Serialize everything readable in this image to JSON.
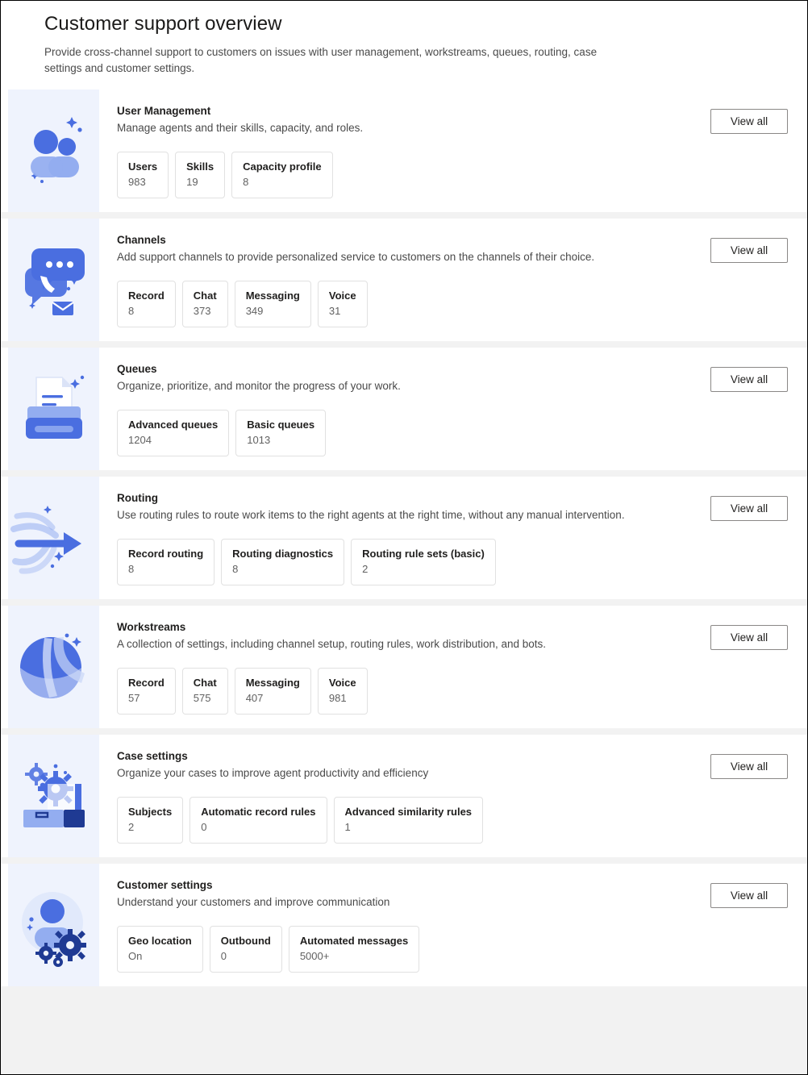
{
  "header": {
    "title": "Customer support overview",
    "subtitle": "Provide cross-channel support to customers on issues with user management, workstreams, queues, routing, case settings and customer settings."
  },
  "common": {
    "view_all_label": "View all"
  },
  "colors": {
    "icon_panel_bg": "#eff3fd",
    "accent_blue": "#4a6ee0",
    "accent_blue_light": "#93adf0",
    "accent_blue_dark": "#1f3a93",
    "page_bg": "#f2f2f2",
    "card_bg": "#ffffff",
    "heading_text": "#201f1e",
    "body_text": "#4a4a4a",
    "value_text": "#616161",
    "tile_border": "#e1e1e1",
    "button_border": "#8a8886"
  },
  "cards": [
    {
      "id": "user-management",
      "icon": "people-icon",
      "heading": "User Management",
      "description": "Manage agents and their skills, capacity, and roles.",
      "action_label": "View all",
      "stats": [
        {
          "label": "Users",
          "value": "983"
        },
        {
          "label": "Skills",
          "value": "19"
        },
        {
          "label": "Capacity profile",
          "value": "8"
        }
      ]
    },
    {
      "id": "channels",
      "icon": "chat-phone-mail-icon",
      "heading": "Channels",
      "description": "Add support channels to provide personalized service to customers on the channels of their choice.",
      "action_label": "View all",
      "stats": [
        {
          "label": "Record",
          "value": "8"
        },
        {
          "label": "Chat",
          "value": "373"
        },
        {
          "label": "Messaging",
          "value": "349"
        },
        {
          "label": "Voice",
          "value": "31"
        }
      ]
    },
    {
      "id": "queues",
      "icon": "document-tray-icon",
      "heading": "Queues",
      "description": "Organize, prioritize, and monitor the progress of your work.",
      "action_label": "View all",
      "stats": [
        {
          "label": "Advanced queues",
          "value": "1204"
        },
        {
          "label": "Basic queues",
          "value": "1013"
        }
      ]
    },
    {
      "id": "routing",
      "icon": "arrow-flow-icon",
      "heading": "Routing",
      "description": "Use routing rules to route work items to the right agents at the right time, without any manual intervention.",
      "action_label": "View all",
      "stats": [
        {
          "label": "Record routing",
          "value": "8"
        },
        {
          "label": "Routing diagnostics",
          "value": "8"
        },
        {
          "label": "Routing rule sets (basic)",
          "value": "2"
        }
      ]
    },
    {
      "id": "workstreams",
      "icon": "sphere-icon",
      "heading": "Workstreams",
      "description": "A collection of settings, including channel setup, routing rules, work distribution, and bots.",
      "action_label": "View all",
      "stats": [
        {
          "label": "Record",
          "value": "57"
        },
        {
          "label": "Chat",
          "value": "575"
        },
        {
          "label": "Messaging",
          "value": "407"
        },
        {
          "label": "Voice",
          "value": "981"
        }
      ]
    },
    {
      "id": "case-settings",
      "icon": "briefcase-gear-icon",
      "heading": "Case settings",
      "description": "Organize your cases to improve agent productivity and efficiency",
      "action_label": "View all",
      "stats": [
        {
          "label": "Subjects",
          "value": "2"
        },
        {
          "label": "Automatic record rules",
          "value": "0"
        },
        {
          "label": "Advanced similarity rules",
          "value": "1"
        }
      ]
    },
    {
      "id": "customer-settings",
      "icon": "person-gear-icon",
      "heading": "Customer settings",
      "description": "Understand your customers and improve communication",
      "action_label": "View all",
      "stats": [
        {
          "label": "Geo location",
          "value": "On"
        },
        {
          "label": "Outbound",
          "value": "0"
        },
        {
          "label": "Automated messages",
          "value": "5000+"
        }
      ]
    }
  ]
}
